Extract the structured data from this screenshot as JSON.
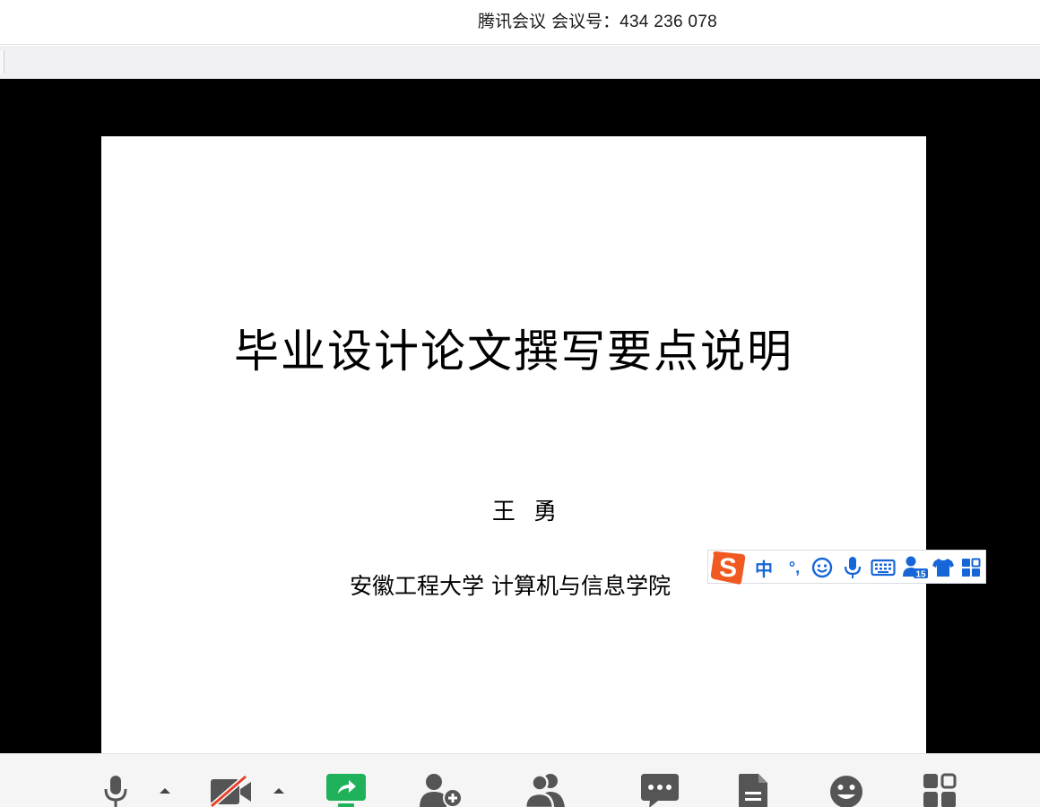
{
  "window": {
    "app_name": "腾讯会议",
    "meeting_label": "会议号：",
    "meeting_id": "434 236 078"
  },
  "slide": {
    "title": "毕业设计论文撰写要点说明",
    "author": "王 勇",
    "affiliation": "安徽工程大学 计算机与信息学院"
  },
  "ime_toolbar": {
    "logo_letter": "S",
    "mode_label": "中",
    "punct_label": "°,",
    "brand_color": "#f05a22",
    "icon_color": "#1666d8",
    "badge": "15",
    "items": [
      "emoji-icon",
      "voice-input-icon",
      "keyboard-icon",
      "user-badge-icon",
      "skin-icon",
      "toolbox-icon"
    ]
  },
  "toolbar": {
    "buttons": [
      {
        "name": "microphone",
        "icon": "microphone-icon"
      },
      {
        "name": "video",
        "icon": "video-off-icon"
      },
      {
        "name": "screen-share",
        "icon": "screen-share-icon",
        "accent": "#20b25a"
      },
      {
        "name": "invite",
        "icon": "add-user-icon"
      },
      {
        "name": "members",
        "icon": "members-icon"
      },
      {
        "name": "chat",
        "icon": "chat-icon"
      },
      {
        "name": "document",
        "icon": "document-icon"
      },
      {
        "name": "reactions",
        "icon": "smiley-icon"
      },
      {
        "name": "apps",
        "icon": "apps-icon"
      }
    ]
  }
}
